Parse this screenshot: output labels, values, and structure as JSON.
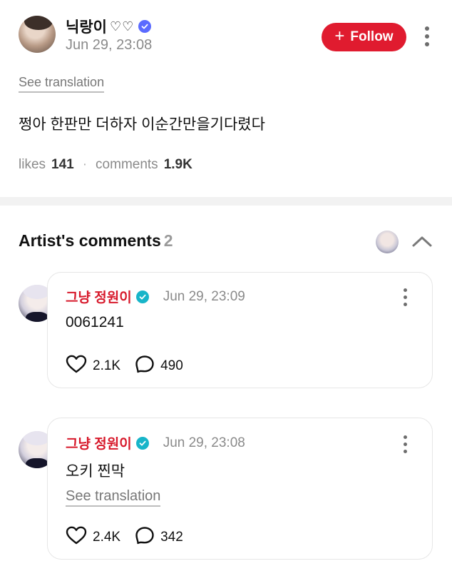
{
  "post": {
    "author": "닉랑이",
    "author_hearts": "♡♡",
    "timestamp": "Jun 29, 23:08",
    "follow_label": "Follow",
    "see_translation": "See translation",
    "text": "쩡아 한판만 더하자 이순간만을기다렸다",
    "likes_label": "likes",
    "likes_count": "141",
    "comments_label": "comments",
    "comments_count": "1.9K",
    "icons": [
      "verified-badge-icon",
      "plus-icon",
      "more-vertical-icon"
    ],
    "colors": {
      "follow_button": "#e01b2f",
      "verified_badge": "#5b6bff"
    }
  },
  "artist_comments": {
    "title": "Artist's comments",
    "count": "2",
    "icons": [
      "avatar",
      "chevron-up-icon"
    ],
    "items": [
      {
        "author": "그냥 정원이",
        "timestamp": "Jun 29, 23:09",
        "text": "0061241",
        "likes": "2.1K",
        "replies": "490"
      },
      {
        "author": "그냥 정원이",
        "timestamp": "Jun 29, 23:08",
        "text": "오키 찐막",
        "see_translation": "See translation",
        "likes": "2.4K",
        "replies": "342"
      }
    ],
    "colors": {
      "artist_name": "#d7182a",
      "verified_badge": "#18b5c9"
    }
  }
}
